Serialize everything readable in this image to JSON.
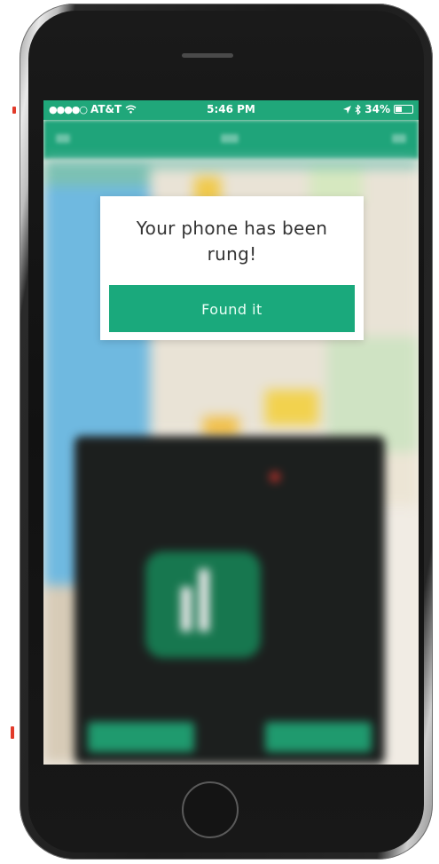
{
  "status_bar": {
    "signal": "●●●●○",
    "carrier": "AT&T",
    "time": "5:46 PM",
    "battery": "34%",
    "battery_level": 0.34
  },
  "modal": {
    "message": "Your phone has been rung!",
    "button_label": "Found it"
  },
  "colors": {
    "accent": "#1aa97c",
    "status_bar": "#20a77a"
  },
  "icons": [
    "wifi-icon",
    "location-arrow-icon",
    "bluetooth-icon",
    "battery-icon"
  ]
}
